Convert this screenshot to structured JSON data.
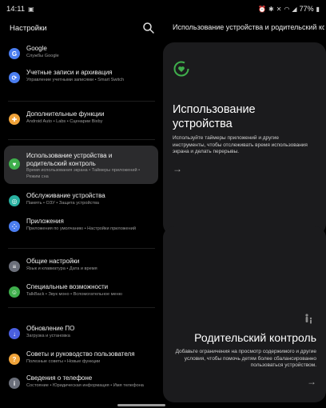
{
  "status": {
    "time": "14:11",
    "battery": "77%"
  },
  "left": {
    "title": "Настройки",
    "items": [
      {
        "title": "Google",
        "subtitle": "Службы Google",
        "icon": "google-icon",
        "color": "#4a7df0"
      },
      {
        "title": "Учетные записи и архивация",
        "subtitle": "Управление учетными записями  •  Smart Switch",
        "icon": "sync-icon",
        "color": "#4a7df0"
      },
      {
        "title": "Дополнительные функции",
        "subtitle": "Android Auto  •  Labs  •  Сценарии Bixby",
        "icon": "star-gear-icon",
        "color": "#f0a33a"
      },
      {
        "title": "Использование устройства и родительский контроль",
        "subtitle": "Время использования экрана  •  Таймеры приложений  •  Режим сна",
        "icon": "wellbeing-icon",
        "color": "#3fae4c"
      },
      {
        "title": "Обслуживание устройства",
        "subtitle": "Память  •  ОЗУ  •  Защита устройства",
        "icon": "care-icon",
        "color": "#28b0a0"
      },
      {
        "title": "Приложения",
        "subtitle": "Приложения по умолчанию  •  Настройки приложений",
        "icon": "apps-icon",
        "color": "#4a7df0"
      },
      {
        "title": "Общие настройки",
        "subtitle": "Язык и клавиатура  •  Дата и время",
        "icon": "sliders-icon",
        "color": "#6b6f7a"
      },
      {
        "title": "Специальные возможности",
        "subtitle": "TalkBack  •  Звук моно  •  Вспомогательное меню",
        "icon": "accessibility-icon",
        "color": "#3fae4c"
      },
      {
        "title": "Обновление ПО",
        "subtitle": "Загрузка и установка",
        "icon": "update-icon",
        "color": "#4a5fe0"
      },
      {
        "title": "Советы и руководство пользователя",
        "subtitle": "Полезные советы  •  Новые функции",
        "icon": "tips-icon",
        "color": "#f0a33a"
      },
      {
        "title": "Сведения о телефоне",
        "subtitle": "Состояние  •  Юридическая информация  •  Имя телефона",
        "icon": "info-icon",
        "color": "#6b6f7a"
      }
    ]
  },
  "right": {
    "title": "Использование устройства и родительский ко...",
    "card1": {
      "heading_line1": "Использование",
      "heading_line2": "устройства",
      "description": "Используйте таймеры приложений и другие инструменты, чтобы отслеживать время использования экрана и делать перерывы.",
      "arrow": "→"
    },
    "card2": {
      "heading": "Родительский контроль",
      "description": "Добавьте ограничения на просмотр содержимого и другие условия, чтобы помочь детям более сбалансированно пользоваться устройством.",
      "arrow": "→"
    }
  }
}
